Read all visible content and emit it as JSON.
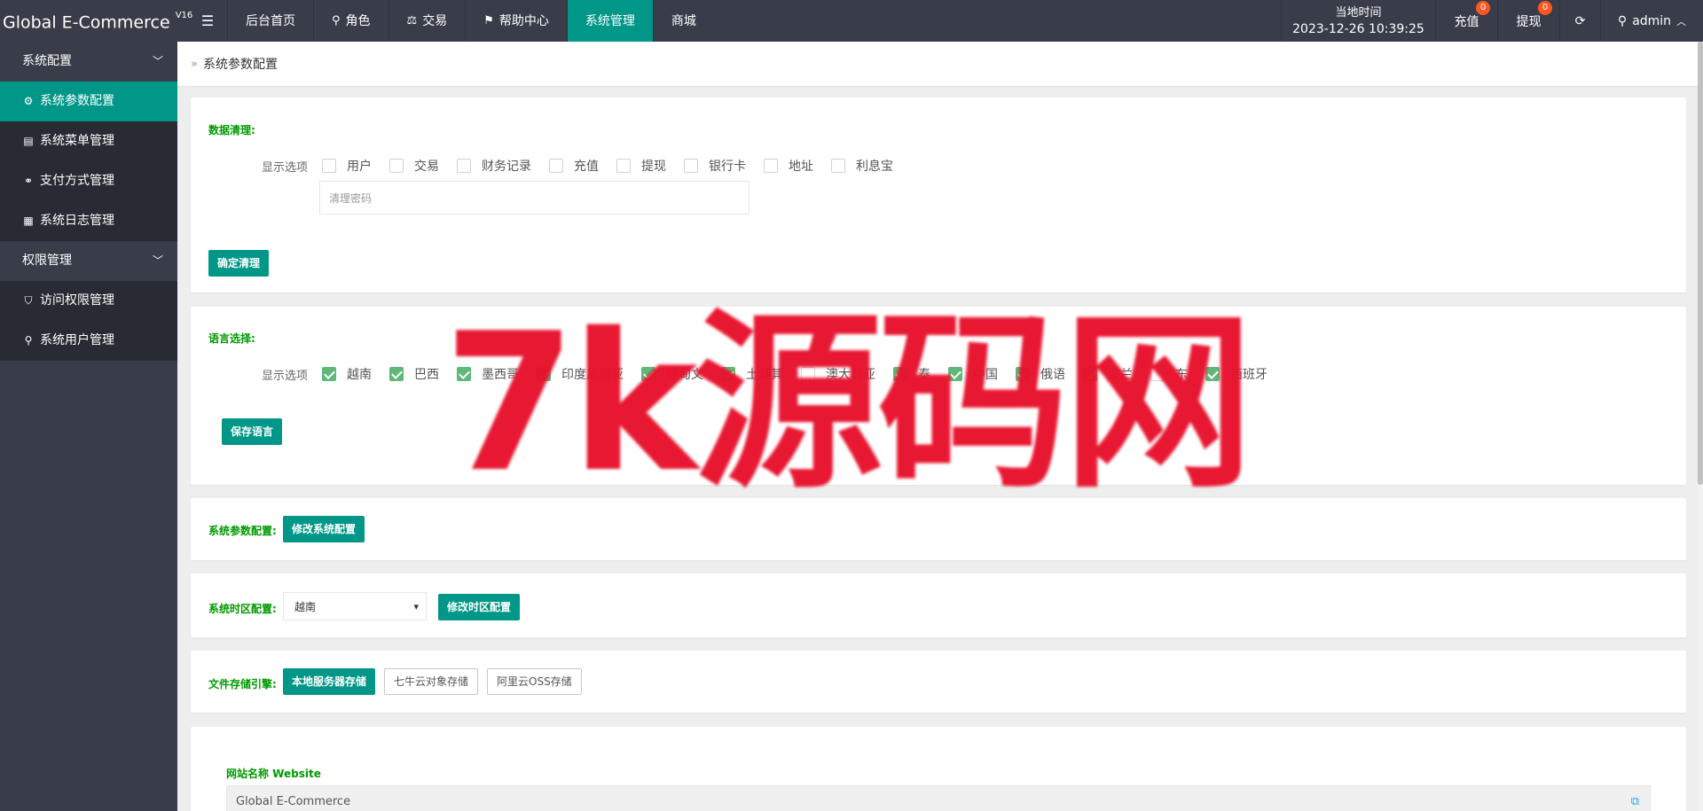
{
  "app": {
    "title": "Global E-Commerce",
    "version": "V16"
  },
  "topnav": [
    {
      "label": "后台首页",
      "icon": ""
    },
    {
      "label": "角色",
      "icon": "user-icon"
    },
    {
      "label": "交易",
      "icon": "scale-icon"
    },
    {
      "label": "帮助中心",
      "icon": "flag-icon"
    },
    {
      "label": "系统管理",
      "icon": "",
      "active": true
    },
    {
      "label": "商城",
      "icon": ""
    }
  ],
  "header_right": {
    "time_label": "当地时间",
    "time_value": "2023-12-26 10:39:25",
    "recharge_label": "充值",
    "recharge_count": "0",
    "withdraw_label": "提现",
    "withdraw_count": "0",
    "user_label": "admin"
  },
  "sidebar": {
    "groups": [
      {
        "label": "系统配置",
        "items": [
          {
            "label": "系统参数配置",
            "icon": "gear-icon",
            "active": true
          },
          {
            "label": "系统菜单管理",
            "icon": "calendar-icon"
          },
          {
            "label": "支付方式管理",
            "icon": "link-icon"
          },
          {
            "label": "系统日志管理",
            "icon": "clipboard-icon"
          }
        ]
      },
      {
        "label": "权限管理",
        "items": [
          {
            "label": "访问权限管理",
            "icon": "shield-icon"
          },
          {
            "label": "系统用户管理",
            "icon": "user-icon"
          }
        ]
      }
    ]
  },
  "breadcrumb": "系统参数配置",
  "data_clean": {
    "title": "数据清理:",
    "options_label": "显示选项",
    "options": [
      "用户",
      "交易",
      "财务记录",
      "充值",
      "提现",
      "银行卡",
      "地址",
      "利息宝"
    ],
    "password_placeholder": "清理密码",
    "confirm_button": "确定清理"
  },
  "language": {
    "title": "语言选择:",
    "options_label": "显示选项",
    "options": [
      "越南",
      "巴西",
      "墨西哥",
      "印度尼西亚",
      "缅甸文",
      "土耳其",
      "澳大利亚",
      "泰",
      "中国",
      "俄语",
      "波兰",
      "东",
      "西班牙"
    ],
    "checked": [
      true,
      true,
      true,
      true,
      true,
      true,
      false,
      true,
      true,
      true,
      true,
      false,
      true
    ],
    "save_button": "保存语言"
  },
  "sys_param": {
    "label": "系统参数配置:",
    "button": "修改系统配置"
  },
  "timezone": {
    "label": "系统时区配置:",
    "selected": "越南",
    "button": "修改时区配置"
  },
  "storage": {
    "label": "文件存储引擎:",
    "options": [
      "本地服务器存储",
      "七牛云对象存储",
      "阿里云OSS存储"
    ],
    "active_index": 0
  },
  "website": {
    "label": "网站名称 Website",
    "value": "Global E-Commerce"
  },
  "watermark": {
    "text": "7k源码网"
  },
  "colors": {
    "header_bg": "#393d49",
    "accent": "#009688",
    "green_label": "#009900",
    "badge": "#ff5722",
    "watermark": "#e8112d"
  }
}
